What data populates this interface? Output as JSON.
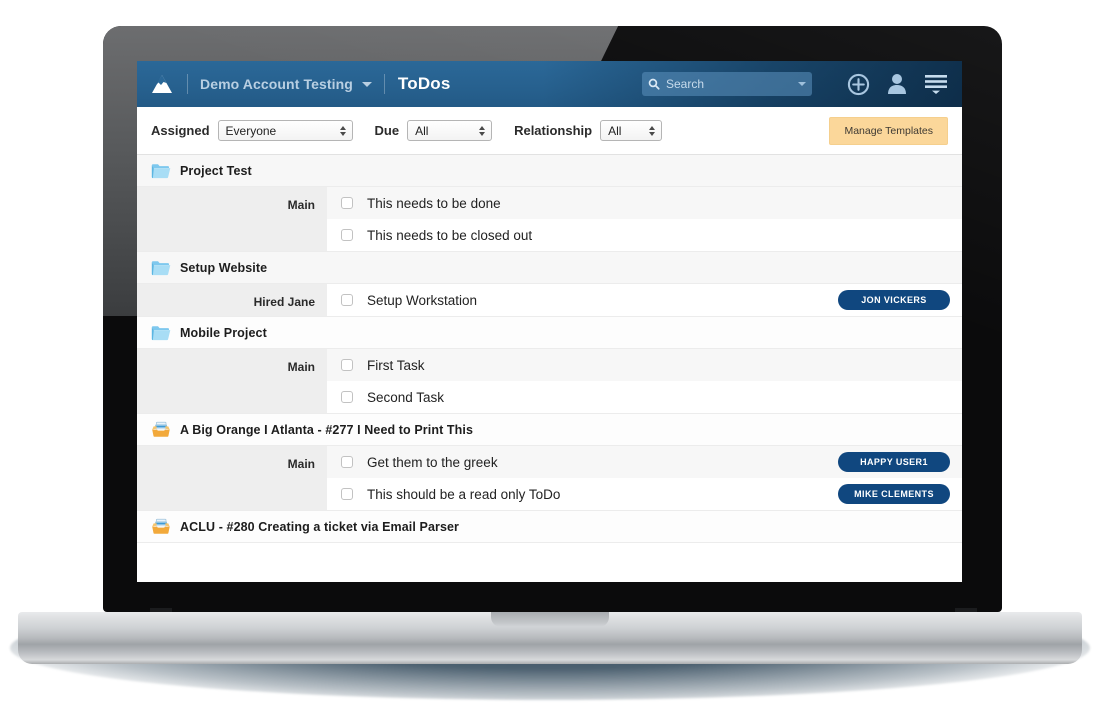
{
  "header": {
    "logo_icon": "mountain-logo",
    "account_name": "Demo Account Testing",
    "account_caret_icon": "caret-down-icon",
    "page_title": "ToDos",
    "search": {
      "icon": "search-icon",
      "placeholder": "Search",
      "value": "",
      "caret_icon": "caret-down-icon"
    },
    "actions": [
      {
        "name": "add-button",
        "icon": "plus-circle-icon"
      },
      {
        "name": "profile-button",
        "icon": "user-icon"
      },
      {
        "name": "menu-button",
        "icon": "hamburger-menu-icon"
      }
    ],
    "colors": {
      "bar": "#27618f",
      "title": "#ffffff",
      "account": "#b9cfe2"
    }
  },
  "filters": {
    "assigned": {
      "label": "Assigned",
      "value": "Everyone"
    },
    "due": {
      "label": "Due",
      "value": "All"
    },
    "relationship": {
      "label": "Relationship",
      "value": "All"
    },
    "manage_templates_label": "Manage Templates",
    "manage_templates_color": "#fbd79a"
  },
  "list": {
    "groups": [
      {
        "icon": "folder-icon",
        "icon_type": "folder",
        "title": "Project Test",
        "header_style": "shaded",
        "section_label": "Main",
        "tasks": [
          {
            "checked": false,
            "title": "This needs to be done",
            "badge": "",
            "row_style": "alt"
          },
          {
            "checked": false,
            "title": "This needs to be closed out",
            "badge": "",
            "row_style": "plain"
          }
        ]
      },
      {
        "icon": "folder-icon",
        "icon_type": "folder",
        "title": "Setup Website",
        "header_style": "shaded",
        "section_label": "Hired Jane",
        "tasks": [
          {
            "checked": false,
            "title": "Setup Workstation",
            "badge": "JON VICKERS",
            "row_style": "plain"
          }
        ]
      },
      {
        "icon": "folder-icon",
        "icon_type": "folder",
        "title": "Mobile Project",
        "header_style": "plain",
        "section_label": "Main",
        "tasks": [
          {
            "checked": false,
            "title": "First Task",
            "badge": "",
            "row_style": "alt"
          },
          {
            "checked": false,
            "title": "Second Task",
            "badge": "",
            "row_style": "plain"
          }
        ]
      },
      {
        "icon": "ticket-tray-icon",
        "icon_type": "ticket",
        "title": "A Big Orange I Atlanta - #277 I Need to Print This",
        "header_style": "plain",
        "section_label": "Main",
        "tasks": [
          {
            "checked": false,
            "title": "Get them to the greek",
            "badge": "HAPPY USER1",
            "row_style": "alt"
          },
          {
            "checked": false,
            "title": "This should be a read only ToDo",
            "badge": "MIKE CLEMENTS",
            "row_style": "plain"
          }
        ]
      },
      {
        "icon": "ticket-tray-icon",
        "icon_type": "ticket",
        "title": "ACLU - #280 Creating a ticket via Email Parser",
        "header_style": "plain",
        "section_label": "",
        "tasks": []
      }
    ],
    "badge_color": "#10477f"
  }
}
